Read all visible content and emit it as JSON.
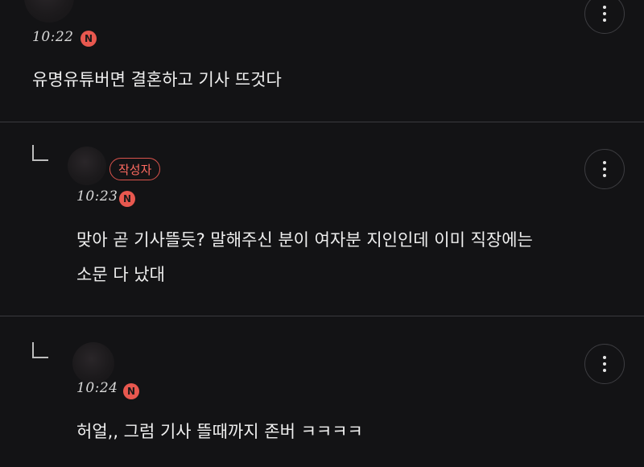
{
  "comments": [
    {
      "time": "10:22",
      "new_badge": "N",
      "body": "유명유튜버면 결혼하고 기사 뜨것다",
      "more_icon": "more-vertical-icon"
    },
    {
      "time": "10:23",
      "new_badge": "N",
      "author_badge": "작성자",
      "body": "맞아 곧 기사뜰듯? 말해주신 분이 여자분 지인인데 이미 직장에는\n소문 다 났대",
      "more_icon": "more-vertical-icon",
      "reply_icon": "reply-arrow-icon"
    },
    {
      "time": "10:24",
      "new_badge": "N",
      "body": "허얼,, 그럼 기사 뜰때까지 존버 ㅋㅋㅋㅋ",
      "more_icon": "more-vertical-icon",
      "reply_icon": "reply-arrow-icon"
    }
  ],
  "colors": {
    "background": "#131315",
    "divider": "#3a3a3e",
    "new_badge": "#e8584f",
    "author_badge": "#ff6b61"
  }
}
